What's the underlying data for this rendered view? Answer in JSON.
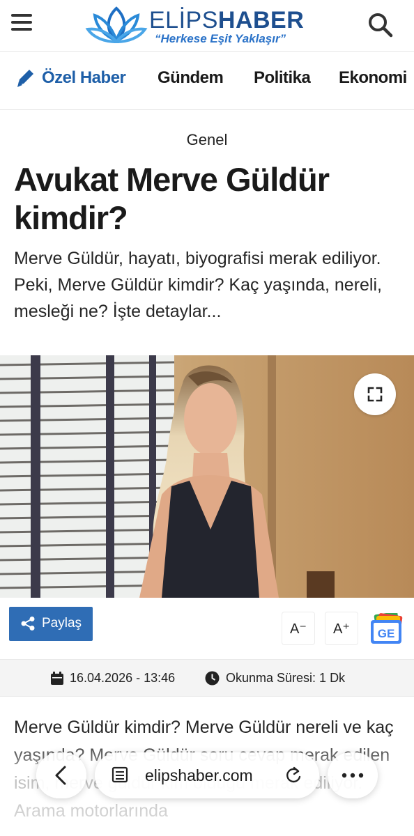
{
  "header": {
    "logo_word_light": "ELİPS",
    "logo_word_bold": "HABER",
    "logo_slogan": "“Herkese Eşit Yaklaşır”",
    "menu_icon": "hamburger-menu-icon",
    "search_icon": "search-icon"
  },
  "nav": {
    "items": [
      {
        "label": "Özel Haber",
        "icon": "pencil-icon"
      },
      {
        "label": "Gündem"
      },
      {
        "label": "Politika"
      },
      {
        "label": "Ekonomi"
      }
    ]
  },
  "article": {
    "category": "Genel",
    "title": "Avukat Merve Güldür kimdir?",
    "summary": "Merve Güldür, hayatı, biyografisi merak ediliyor. Peki, Merve Güldür kimdir? Kaç yaşında, nereli, mesleği ne? İşte detaylar...",
    "body": "Merve Güldür kimdir? Merve Güldür nereli ve kaç yaşında? Merve Güldür soru cevap merak edilen isim, merve güldür kim olduğu merak ediliyor. Arama motorlarında"
  },
  "tools": {
    "share_label": "Paylaş",
    "font_decrease": "A⁻",
    "font_increase": "A⁺",
    "google_news_label": "GE"
  },
  "meta": {
    "date": "16.04.2026 - 13:46",
    "read_time": "Okunma Süresi: 1 Dk"
  },
  "browser": {
    "url": "elipshaber.com"
  },
  "colors": {
    "brand_blue": "#1e4f8f",
    "accent_blue": "#2f6db5"
  }
}
